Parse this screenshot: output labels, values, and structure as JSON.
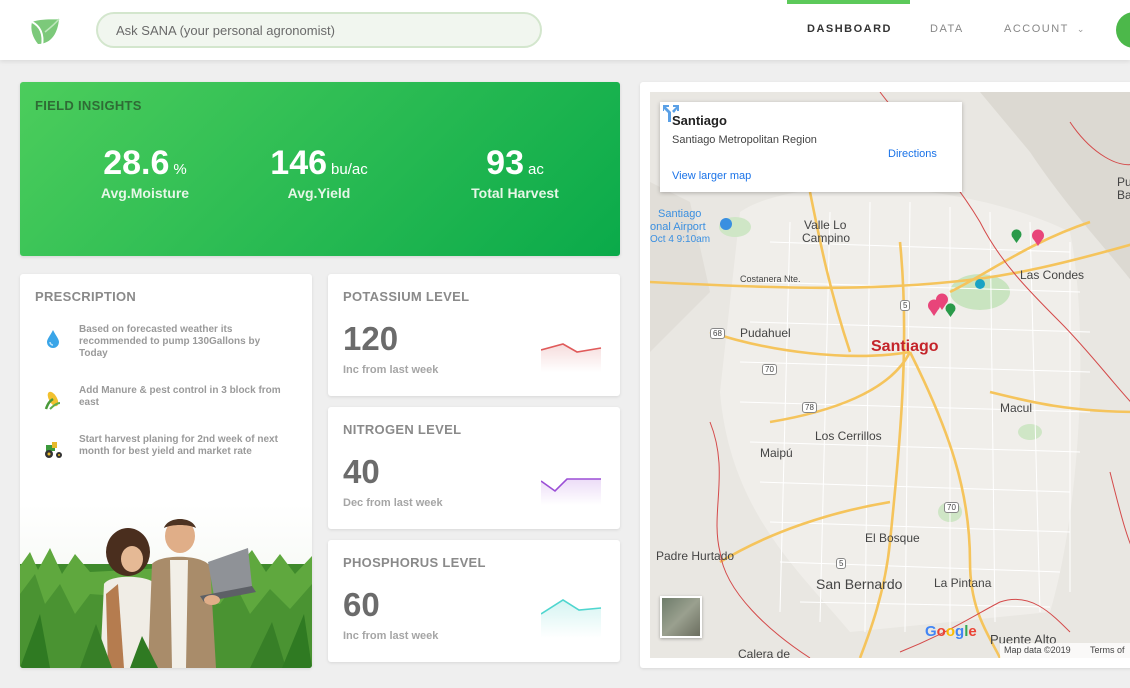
{
  "header": {
    "search_placeholder": "Ask SANA (your personal agronomist)",
    "nav": [
      "DASHBOARD",
      "DATA",
      "ACCOUNT"
    ],
    "active_nav": "DASHBOARD",
    "accent_color": "#5cc95a"
  },
  "insights": {
    "title": "FIELD INSIGHTS",
    "metrics": [
      {
        "value": "28.6",
        "unit": "%",
        "label": "Avg.Moisture"
      },
      {
        "value": "146",
        "unit": "bu/ac",
        "label": "Avg.Yield"
      },
      {
        "value": "93",
        "unit": "ac",
        "label": "Total Harvest"
      }
    ]
  },
  "prescription": {
    "title": "PRESCRIPTION",
    "items": [
      {
        "icon": "water-drop-icon",
        "text": "Based on forecasted weather its recommended to pump 130Gallons by Today"
      },
      {
        "icon": "corn-icon",
        "text": "Add Manure & pest control in 3 block from east"
      },
      {
        "icon": "tractor-icon",
        "text": "Start harvest planing for 2nd week of next month for best yield and market rate"
      }
    ]
  },
  "levels": [
    {
      "title": "POTASSIUM LEVEL",
      "value": "120",
      "note": "Inc from last week",
      "color": "#e05a5a",
      "trend": [
        3,
        2,
        5,
        4
      ]
    },
    {
      "title": "NITROGEN LEVEL",
      "value": "40",
      "note": "Dec from last week",
      "color": "#9b4fd6",
      "trend": [
        2,
        5,
        3,
        1
      ]
    },
    {
      "title": "PHOSPHORUS LEVEL",
      "value": "60",
      "note": "Inc from last week",
      "color": "#4fd6cf",
      "trend": [
        5,
        2,
        4,
        3
      ]
    }
  ],
  "map": {
    "info_title": "Santiago",
    "info_subtitle": "Santiago Metropolitan Region",
    "directions": "Directions",
    "larger_map": "View larger map",
    "city": "Santiago",
    "places": [
      "Santiago",
      "onal Airport",
      "Oct 4 9:10am",
      "Valle Lo",
      "Campino",
      "Costanera Nte.",
      "Las Condes",
      "Pudahuel",
      "Pu",
      "Ba",
      "Macul",
      "Los Cerrillos",
      "Maipú",
      "El Bosque",
      "Padre Hurtado",
      "San Bernardo",
      "La Pintana",
      "Puente Alto",
      "Calera de"
    ],
    "shields": [
      "68",
      "70",
      "78",
      "5",
      "70",
      "5"
    ],
    "google": "Google",
    "map_data": "Map data ©2019",
    "terms": "Terms of"
  }
}
